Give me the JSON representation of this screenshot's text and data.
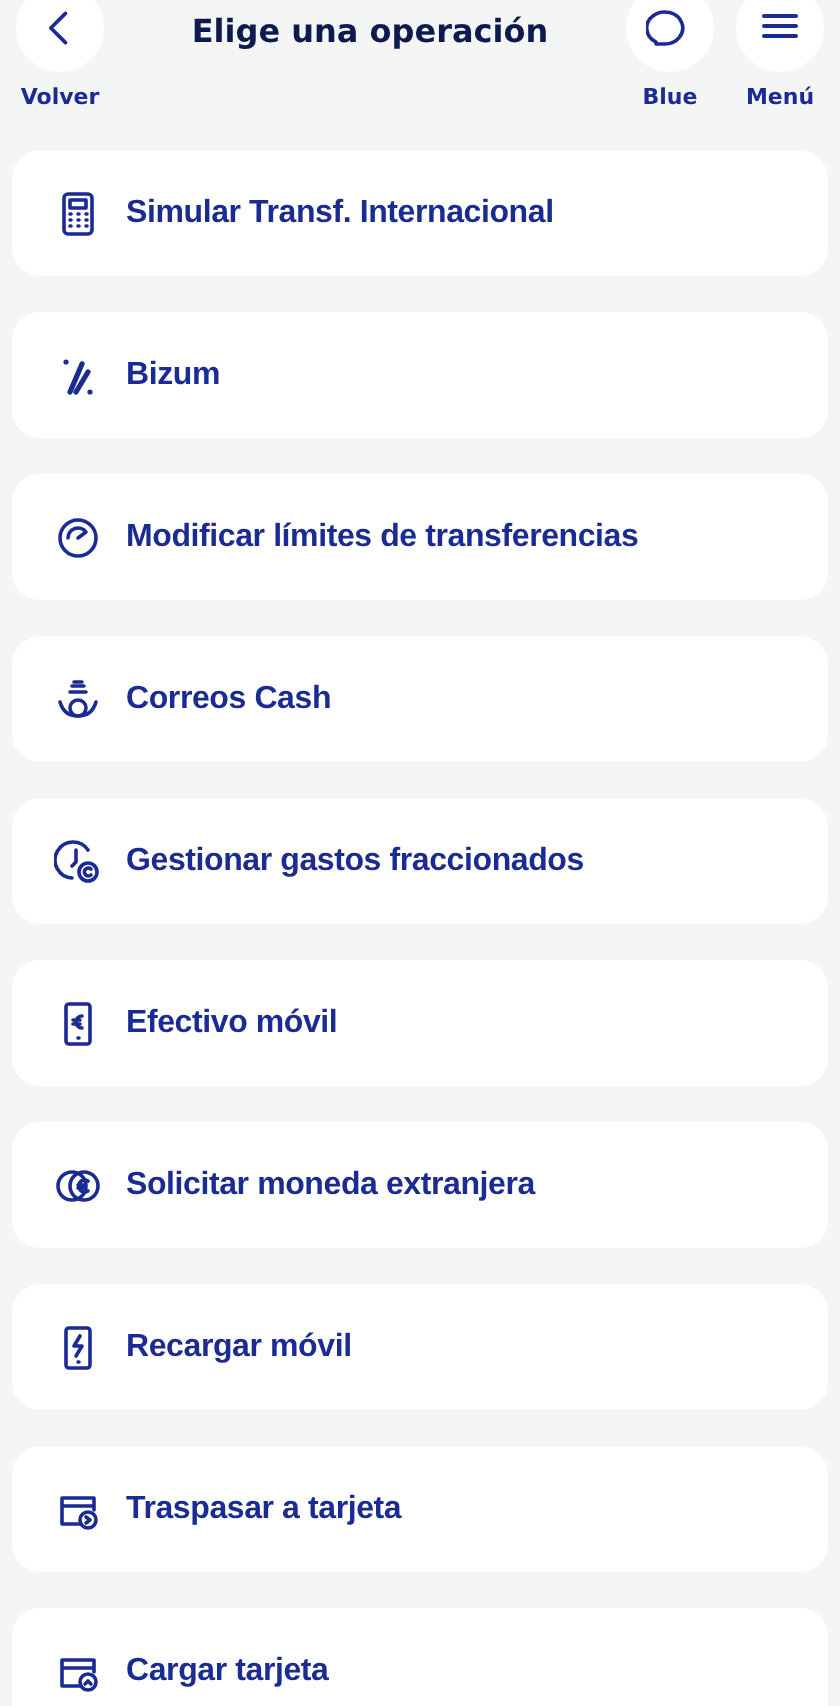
{
  "header": {
    "title": "Elige una operación",
    "back": {
      "label": "Volver"
    },
    "actions": [
      {
        "label": "Blue"
      },
      {
        "label": "Menú"
      }
    ]
  },
  "operations": [
    {
      "label": "Simular Transf. Internacional"
    },
    {
      "label": "Bizum"
    },
    {
      "label": "Modificar límites de transferencias"
    },
    {
      "label": "Correos Cash"
    },
    {
      "label": "Gestionar gastos fraccionados"
    },
    {
      "label": "Efectivo móvil"
    },
    {
      "label": "Solicitar moneda extranjera"
    },
    {
      "label": "Recargar móvil"
    },
    {
      "label": "Traspasar a tarjeta"
    },
    {
      "label": "Cargar tarjeta"
    }
  ]
}
